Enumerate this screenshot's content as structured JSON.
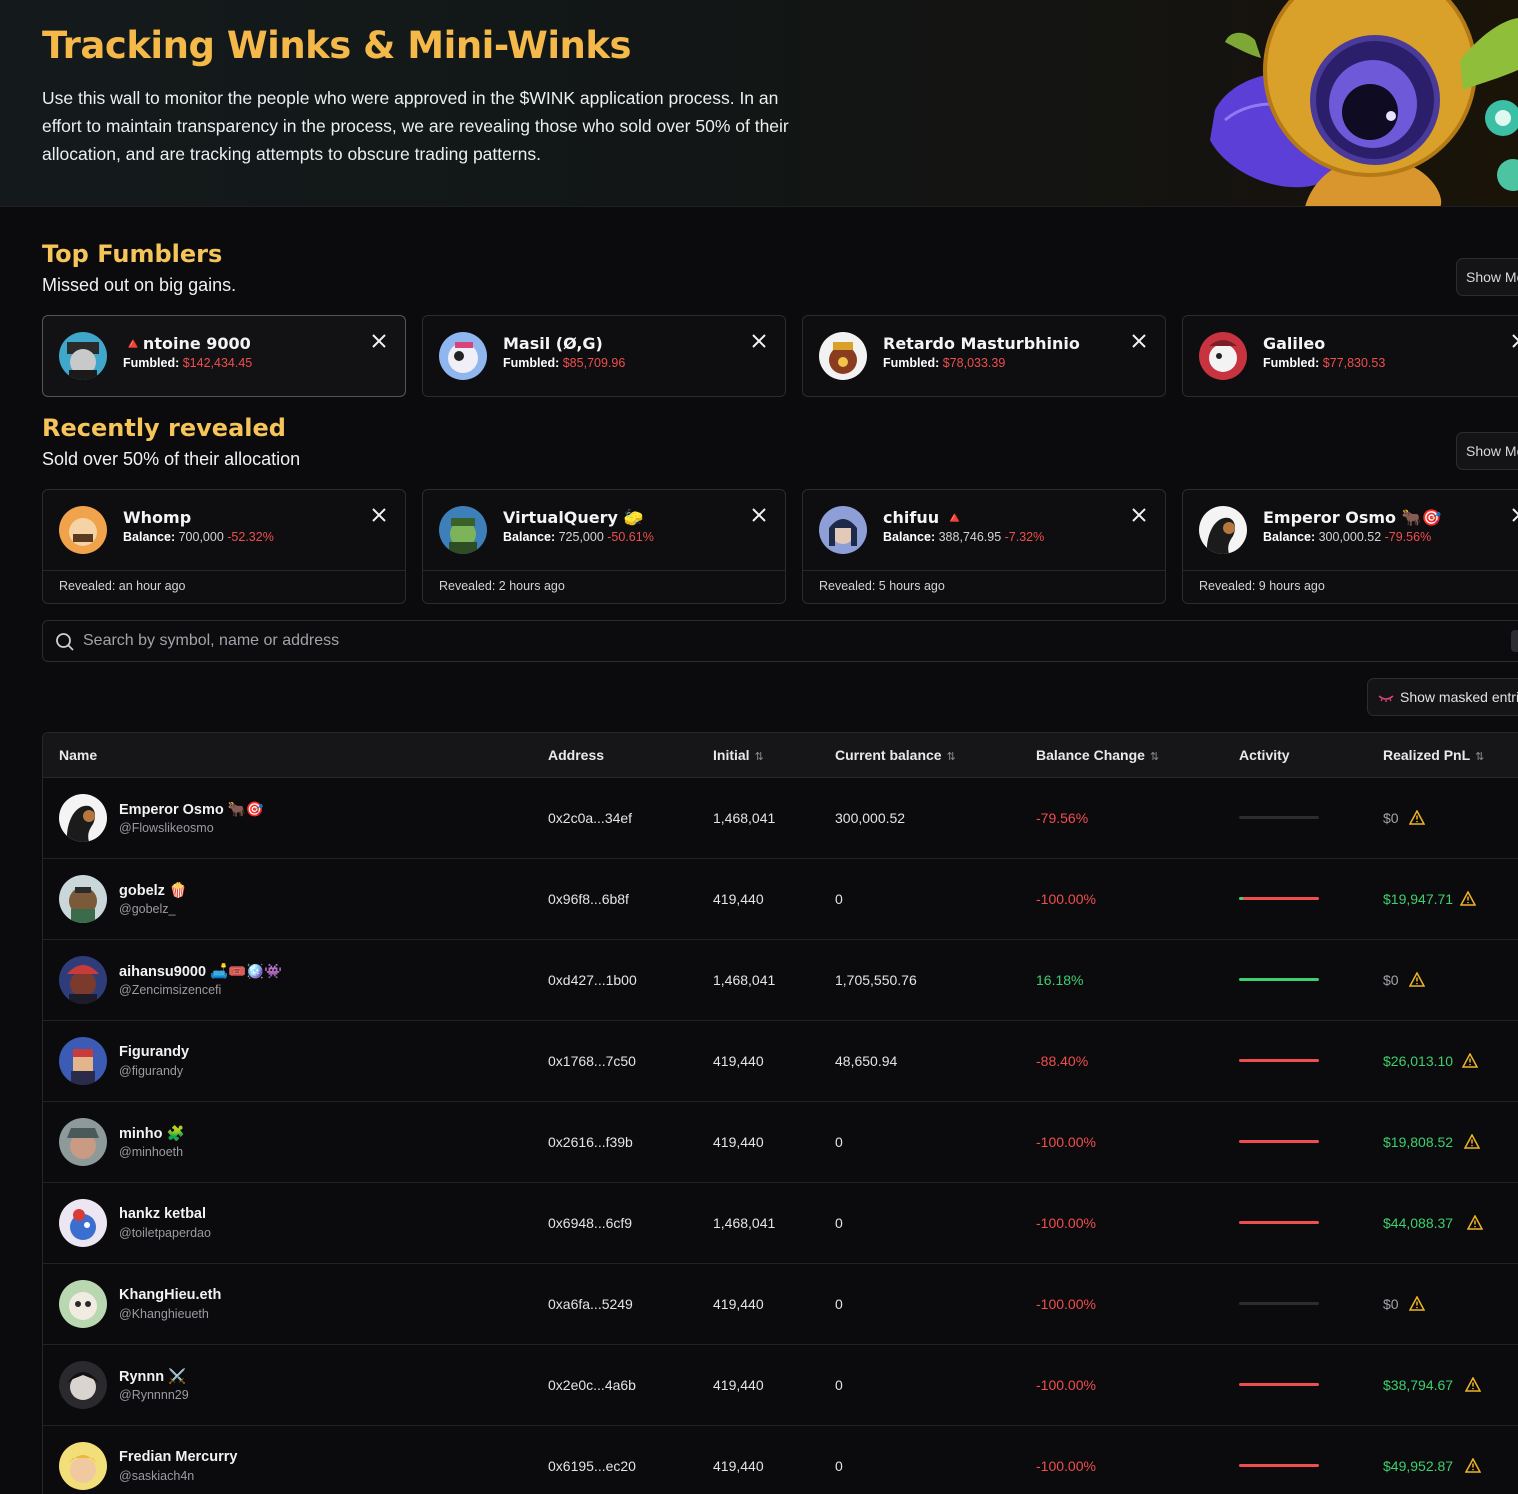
{
  "hero": {
    "title": "Tracking Winks & Mini-Winks",
    "description": "Use this wall to monitor the people who were approved in the $WINK application process. In an effort to maintain transparency in the process, we are revealing those who sold over 50% of their allocation, and are tracking attempts to obscure trading patterns."
  },
  "top_fumblers": {
    "title": "Top Fumblers",
    "subtitle": "Missed out on big gains.",
    "show_more_label": "Show More",
    "field_label": "Fumbled:",
    "cards": [
      {
        "name": "🔺ntoine 9000",
        "amount": "$142,434.45"
      },
      {
        "name": "Masil (Ø,G)",
        "amount": "$85,709.96"
      },
      {
        "name": "Retardo Masturbhinio",
        "amount": "$78,033.39"
      },
      {
        "name": "Galileo",
        "amount": "$77,830.53"
      }
    ]
  },
  "recently_revealed": {
    "title": "Recently revealed",
    "subtitle": "Sold over 50% of their allocation",
    "show_more_label": "Show More",
    "field_label": "Balance:",
    "revealed_prefix": "Revealed:",
    "cards": [
      {
        "name": "Whomp",
        "balance": "700,000",
        "change": "-52.32%",
        "revealed": "an hour ago"
      },
      {
        "name": "VirtualQuery 🧽",
        "balance": "725,000",
        "change": "-50.61%",
        "revealed": "2 hours ago"
      },
      {
        "name": "chifuu 🔺",
        "balance": "388,746.95",
        "change": "-7.32%",
        "revealed": "5 hours ago"
      },
      {
        "name": "Emperor Osmo 🐂🎯",
        "balance": "300,000.52",
        "change": "-79.56%",
        "revealed": "9 hours ago"
      }
    ]
  },
  "search": {
    "placeholder": "Search by symbol, name or address"
  },
  "masked_button": {
    "label": "Show masked entries"
  },
  "table": {
    "columns": [
      "Name",
      "Address",
      "Initial",
      "Current balance",
      "Balance Change",
      "Activity",
      "Realized PnL"
    ],
    "rows": [
      {
        "name": "Emperor Osmo 🐂🎯",
        "handle": "@Flowslikeosmo",
        "address": "0x2c0a...34ef",
        "initial": "1,468,041",
        "current": "300,000.52",
        "change": "-79.56%",
        "pnl": "$0"
      },
      {
        "name": "gobelz 🍿",
        "handle": "@gobelz_",
        "address": "0x96f8...6b8f",
        "initial": "419,440",
        "current": "0",
        "change": "-100.00%",
        "pnl": "$19,947.71"
      },
      {
        "name": "aihansu9000 🛋️🎟️🪩👾",
        "handle": "@Zencimsizencefi",
        "address": "0xd427...1b00",
        "initial": "1,468,041",
        "current": "1,705,550.76",
        "change": "16.18%",
        "pnl": "$0"
      },
      {
        "name": "Figurandy",
        "handle": "@figurandy",
        "address": "0x1768...7c50",
        "initial": "419,440",
        "current": "48,650.94",
        "change": "-88.40%",
        "pnl": "$26,013.10"
      },
      {
        "name": "minho 🧩",
        "handle": "@minhoeth",
        "address": "0x2616...f39b",
        "initial": "419,440",
        "current": "0",
        "change": "-100.00%",
        "pnl": "$19,808.52"
      },
      {
        "name": "hankz ketbal",
        "handle": "@toiletpaperdao",
        "address": "0x6948...6cf9",
        "initial": "1,468,041",
        "current": "0",
        "change": "-100.00%",
        "pnl": "$44,088.37"
      },
      {
        "name": "KhangHieu.eth",
        "handle": "@Khanghieueth",
        "address": "0xa6fa...5249",
        "initial": "419,440",
        "current": "0",
        "change": "-100.00%",
        "pnl": "$0"
      },
      {
        "name": "Rynnn ⚔️",
        "handle": "@Rynnnn29",
        "address": "0x2e0c...4a6b",
        "initial": "419,440",
        "current": "0",
        "change": "-100.00%",
        "pnl": "$38,794.67"
      },
      {
        "name": "Fredian Mercurry",
        "handle": "@saskiach4n",
        "address": "0x6195...ec20",
        "initial": "419,440",
        "current": "0",
        "change": "-100.00%",
        "pnl": "$49,952.87"
      }
    ]
  },
  "colors": {
    "accent": "#f5b94a",
    "negative": "#ef4e4e",
    "positive": "#3ecf6e",
    "warning": "#f0b429"
  }
}
